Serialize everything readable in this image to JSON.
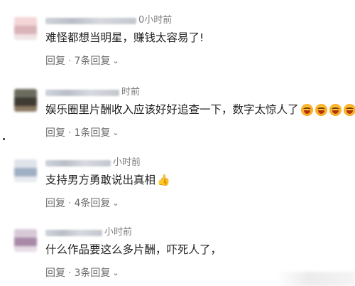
{
  "comments": [
    {
      "time": "小时前",
      "time_visible": "0小时前",
      "text": "难怪都想当明星，赚钱太容易了!",
      "reply_label": "回复",
      "sep": "·",
      "replies_label": "7条回复",
      "avatar_colors": [
        "#f4d6d8",
        "#d9b3b8",
        "#efe4e6"
      ]
    },
    {
      "time": "时前",
      "time_visible": "时前",
      "text": "娱乐圈里片酬收入应该好好追查一下，数字太惊人了",
      "emoji_count": 4,
      "emoji_icon": "grinning-face-icon",
      "reply_label": "回复",
      "sep": "·",
      "replies_label": "1条回复",
      "avatar_colors": [
        "#6b6b5e",
        "#3f3b33",
        "#8b7a62"
      ]
    },
    {
      "time": "小时前",
      "time_visible": "小时前",
      "text": "支持男方勇敢说出真相",
      "trailing_icon": "thumbs-up-icon",
      "reply_label": "回复",
      "sep": "·",
      "replies_label": "4条回复",
      "avatar_colors": [
        "#dfe3ea",
        "#9fb0c4",
        "#e8ebef"
      ]
    },
    {
      "time": "小时前",
      "time_visible": "小时前",
      "text": "什么作品要这么多片酬，吓死人了，",
      "reply_label": "回复",
      "sep": "·",
      "replies_label": "3条回复",
      "avatar_colors": [
        "#d8c9d8",
        "#a88aa8",
        "#e7dde7"
      ]
    }
  ]
}
